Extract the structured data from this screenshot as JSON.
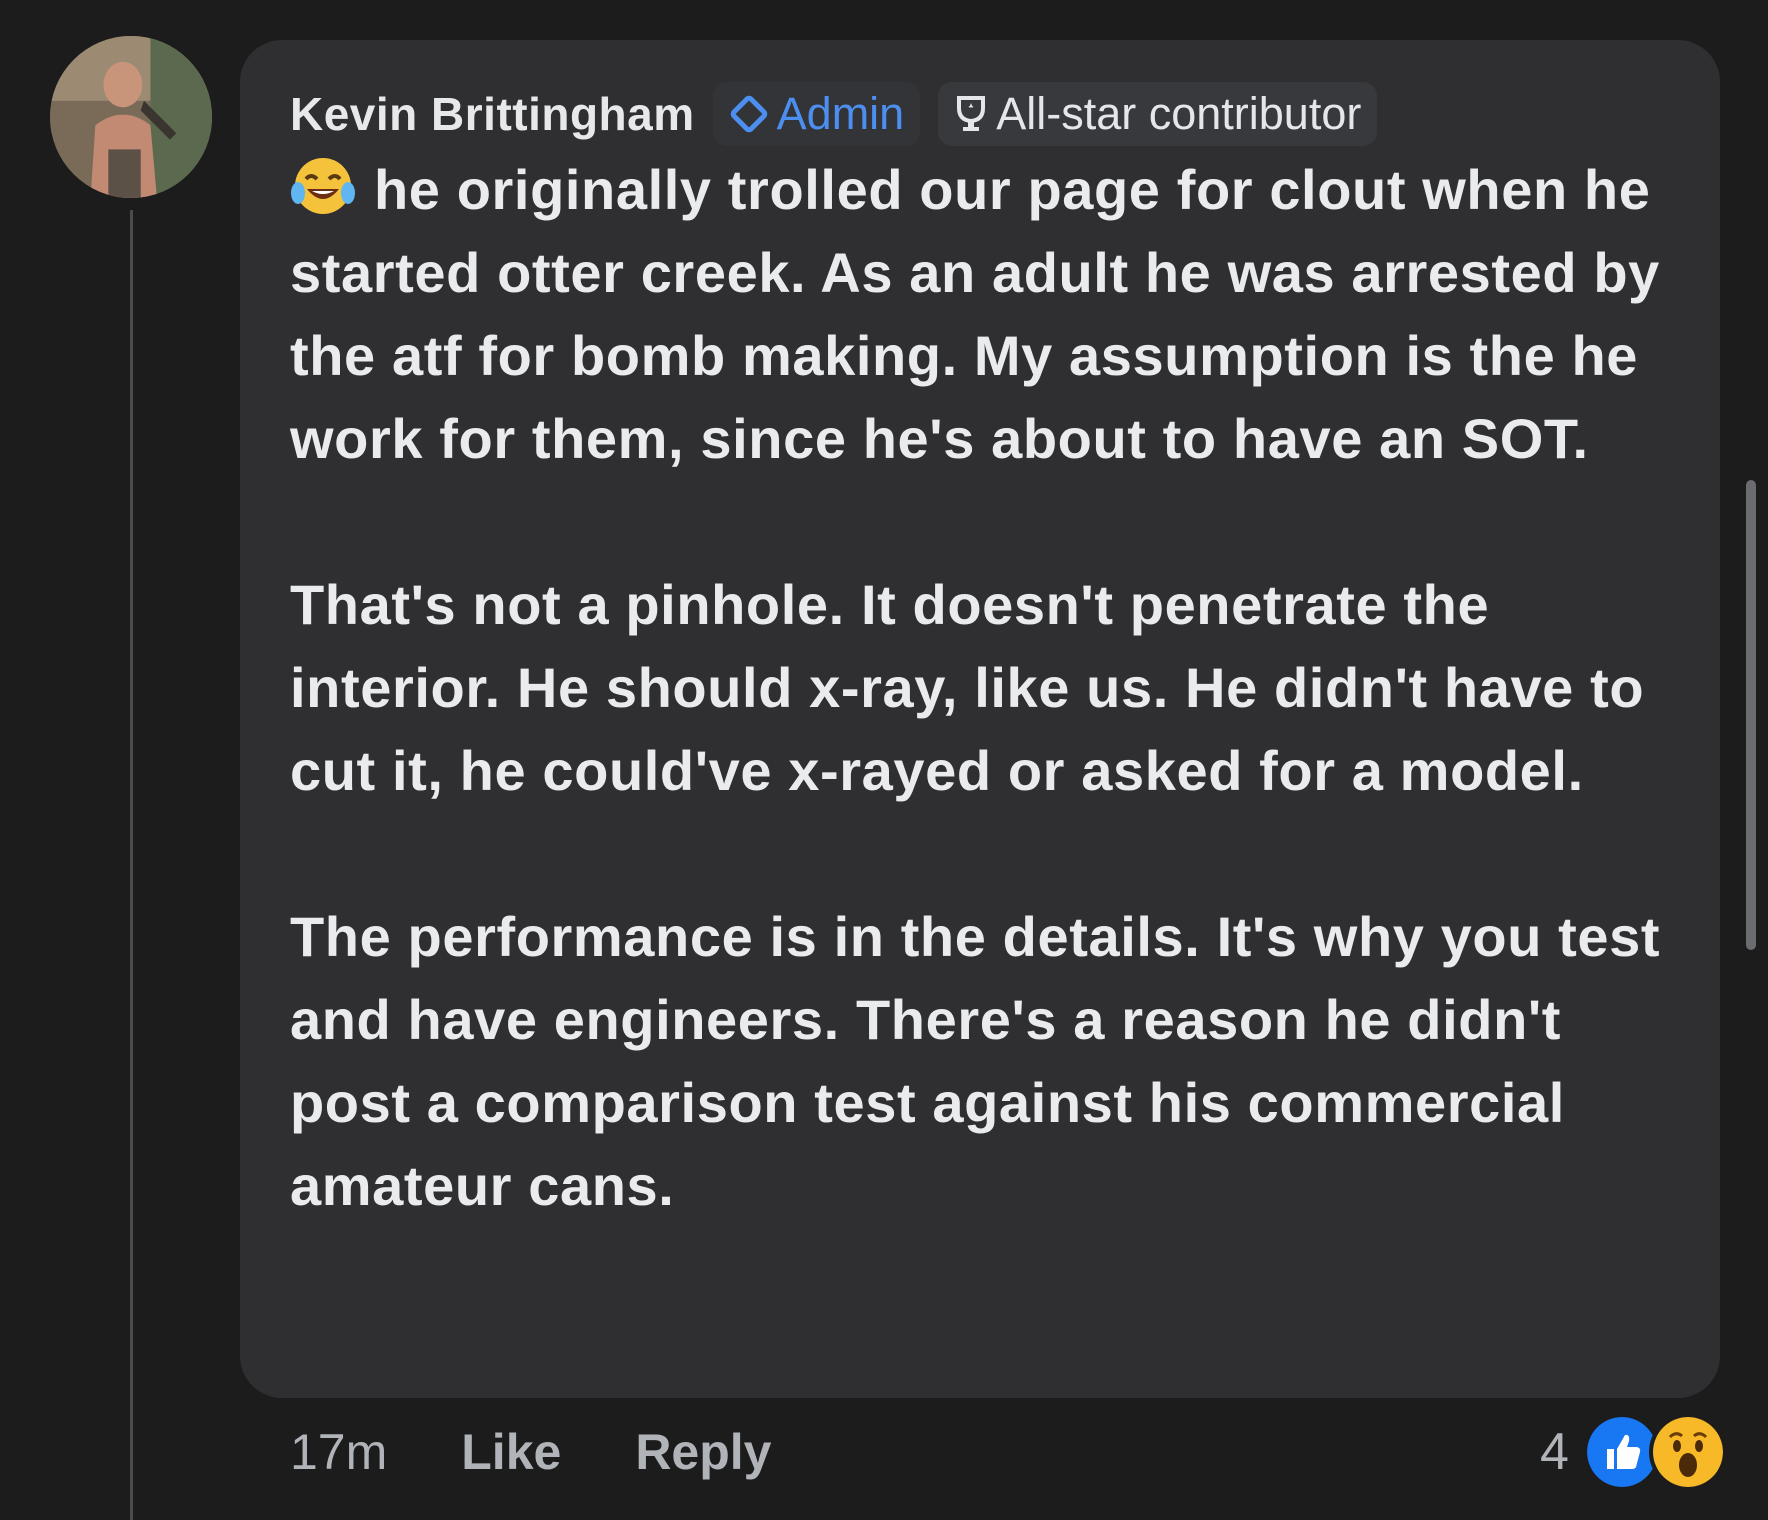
{
  "comment": {
    "author": "Kevin Brittingham",
    "badges": {
      "admin": "Admin",
      "allstar": "All-star contributor"
    },
    "emoji_leading": "laughing-tears-emoji",
    "paragraphs": [
      "he originally trolled our page for clout when he started otter creek. As an adult he was arrested by the atf for bomb making. My assumption is the he work for them, since he's about to have an SOT.",
      "That's not a pinhole. It doesn't penetrate the interior. He should x-ray, like us. He didn't have to cut it, he could've x-rayed or asked for a model.",
      "The performance is in the details. It's why you test and have engineers. There's a reason he didn't post a comparison test against his commercial amateur cans."
    ],
    "footer": {
      "time": "17m",
      "like_label": "Like",
      "reply_label": "Reply"
    },
    "reactions": {
      "count": "4",
      "icons": [
        "like-reaction-icon",
        "wow-reaction-icon"
      ]
    }
  },
  "colors": {
    "background": "#1c1c1d",
    "bubble": "#2f2f31",
    "admin_accent": "#4d8ff0",
    "text": "#eaebed",
    "muted": "#b0b3b8"
  }
}
